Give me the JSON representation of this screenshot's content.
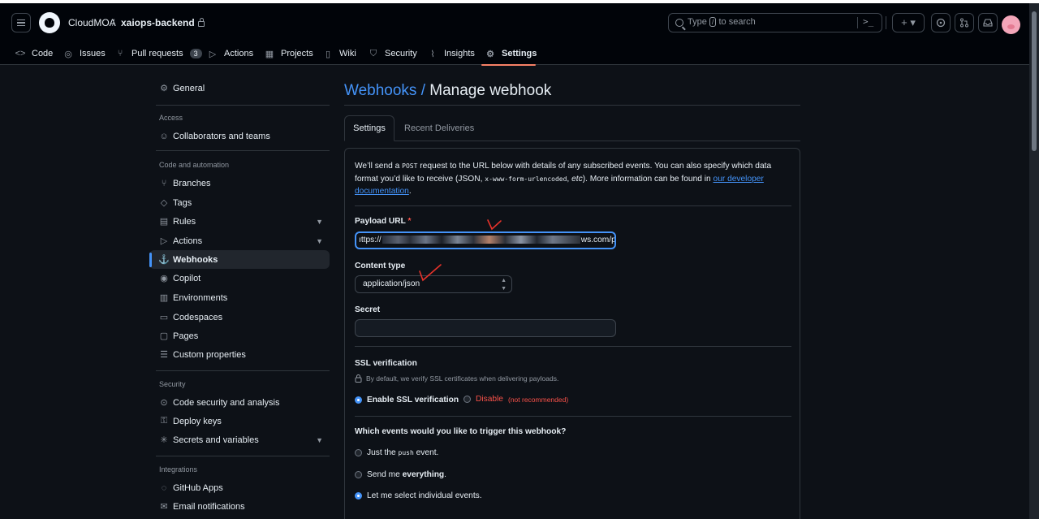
{
  "header": {
    "owner": "CloudMOA",
    "separator": "/",
    "repo": "xaiops-backend",
    "search": {
      "prefix": "Type",
      "key": "/",
      "suffix": "to search"
    },
    "cmd_glyph": ">_",
    "plus_glyph": "+ ▾"
  },
  "repo_nav": [
    {
      "label": "Code",
      "icon": "code-icon"
    },
    {
      "label": "Issues",
      "icon": "issue-icon"
    },
    {
      "label": "Pull requests",
      "icon": "pull-request-icon",
      "count": "3"
    },
    {
      "label": "Actions",
      "icon": "play-icon"
    },
    {
      "label": "Projects",
      "icon": "table-icon"
    },
    {
      "label": "Wiki",
      "icon": "book-icon"
    },
    {
      "label": "Security",
      "icon": "shield-icon"
    },
    {
      "label": "Insights",
      "icon": "graph-icon"
    },
    {
      "label": "Settings",
      "icon": "gear-icon",
      "active": true
    }
  ],
  "sidebar": {
    "general": "General",
    "groups": {
      "access": "Access",
      "code_automation": "Code and automation",
      "security": "Security",
      "integrations": "Integrations"
    },
    "items": {
      "collaborators": "Collaborators and teams",
      "branches": "Branches",
      "tags": "Tags",
      "rules": "Rules",
      "actions": "Actions",
      "webhooks": "Webhooks",
      "copilot": "Copilot",
      "environments": "Environments",
      "codespaces": "Codespaces",
      "pages": "Pages",
      "custom_properties": "Custom properties",
      "code_security": "Code security and analysis",
      "deploy_keys": "Deploy keys",
      "secrets": "Secrets and variables",
      "github_apps": "GitHub Apps",
      "email_notifications": "Email notifications"
    }
  },
  "main": {
    "title_link": "Webhooks /",
    "title": "Manage webhook",
    "tabs": {
      "settings": "Settings",
      "deliveries": "Recent Deliveries"
    },
    "intro": {
      "p1": "We’ll send a",
      "post": "POST",
      "p2": "request to the URL below with details of any subscribed events. You can also specify which data format you’d like to receive (JSON,",
      "urlencoded": "x-www-form-urlencoded",
      "p3": ",",
      "etc": "etc",
      "p4": "). More information can be found in",
      "link": "our developer documentation",
      "end": "."
    },
    "payload_label": "Payload URL",
    "required_mark": "*",
    "payload_prefix": "ıttps://",
    "payload_suffix": "ws.com/prod",
    "content_type_label": "Content type",
    "content_type_value": "application/json",
    "secret_label": "Secret",
    "secret_value": "",
    "ssl_label": "SSL verification",
    "ssl_hint": "By default, we verify SSL certificates when delivering payloads.",
    "ssl_enable": "Enable SSL verification",
    "ssl_disable": "Disable",
    "ssl_not_recommended": "(not recommended)",
    "events_label": "Which events would you like to trigger this webhook?",
    "events": {
      "just_push_a": "Just the",
      "push": "push",
      "just_push_b": "event.",
      "send_me": "Send me",
      "everything": "everything",
      "dot": ".",
      "select": "Let me select individual events."
    }
  }
}
